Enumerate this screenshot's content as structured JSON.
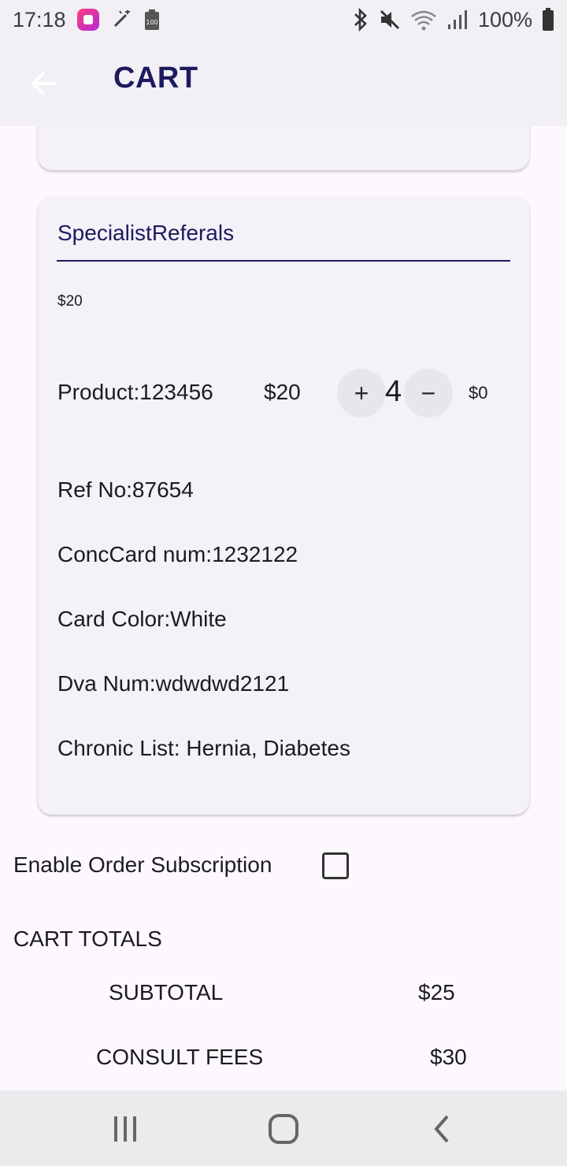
{
  "status_bar": {
    "time": "17:18",
    "battery": "100%",
    "icons": [
      "shopping-app-icon",
      "magic-wand-icon",
      "battery-saver-icon",
      "bluetooth-icon",
      "mute-icon",
      "wifi-icon",
      "signal-icon",
      "battery-icon"
    ]
  },
  "app_bar": {
    "title": "CART",
    "back_icon": "arrow-left-icon"
  },
  "card": {
    "title": "SpecialistReferals",
    "price": "$20",
    "product": {
      "name": "Product:123456",
      "price": "$20",
      "quantity": "4",
      "plus_label": "+",
      "minus_label": "−",
      "line_total": "$0"
    },
    "details": [
      "Ref No:87654",
      "ConcCard num:1232122",
      "Card Color:White",
      "Dva Num:wdwdwd2121",
      "Chronic List: Hernia, Diabetes"
    ]
  },
  "subscription": {
    "label": "Enable Order Subscription",
    "checked": false
  },
  "totals": {
    "title": "CART TOTALS",
    "rows": [
      {
        "label": "SUBTOTAL",
        "value": "$25"
      },
      {
        "label": "CONSULT FEES",
        "value": "$30"
      }
    ]
  },
  "nav_bar": {
    "icons": [
      "recent-apps-icon",
      "home-icon",
      "back-icon"
    ]
  },
  "colors": {
    "title": "#1c1b5e",
    "app_bar": "#f2eff5",
    "card": "#f4f1f8",
    "background": "#fdf8fd"
  }
}
